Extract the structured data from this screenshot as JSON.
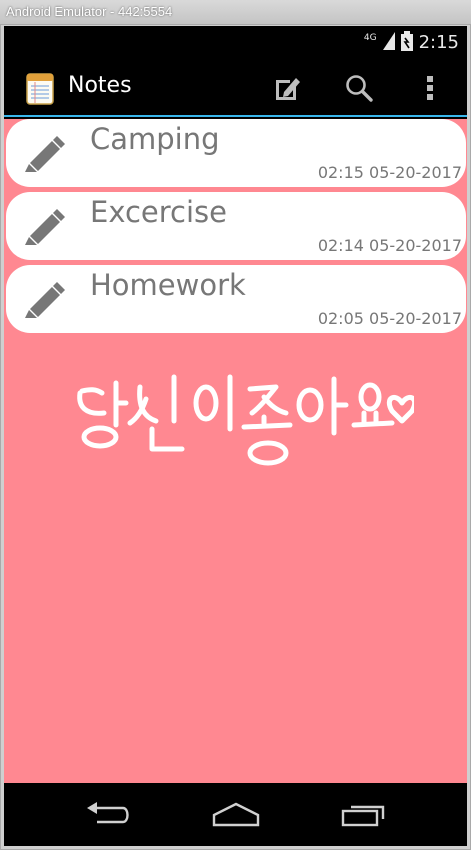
{
  "window": {
    "title": "Android Emulator - 442:5554"
  },
  "status_bar": {
    "network": "4G",
    "time": "2:15",
    "icons": [
      "network-icon",
      "signal-icon",
      "battery-icon"
    ]
  },
  "action_bar": {
    "title": "Notes",
    "icons": [
      "notepad-app-icon",
      "compose-icon",
      "search-icon",
      "overflow-menu-icon"
    ]
  },
  "notes": [
    {
      "title": "Camping",
      "date": "02:15 05-20-2017",
      "icon": "pencil-icon"
    },
    {
      "title": "Excercise",
      "date": "02:14 05-20-2017",
      "icon": "pencil-icon"
    },
    {
      "title": "Homework",
      "date": "02:05 05-20-2017",
      "icon": "pencil-icon"
    }
  ],
  "background": {
    "color": "#ff8891",
    "decoration": "korean-handwriting-with-heart"
  },
  "colors": {
    "accent": "#39b7ec",
    "card": "#ffffff",
    "card_text": "#777777"
  },
  "nav_bar": {
    "icons": [
      "back-icon",
      "home-icon",
      "recent-apps-icon"
    ]
  }
}
